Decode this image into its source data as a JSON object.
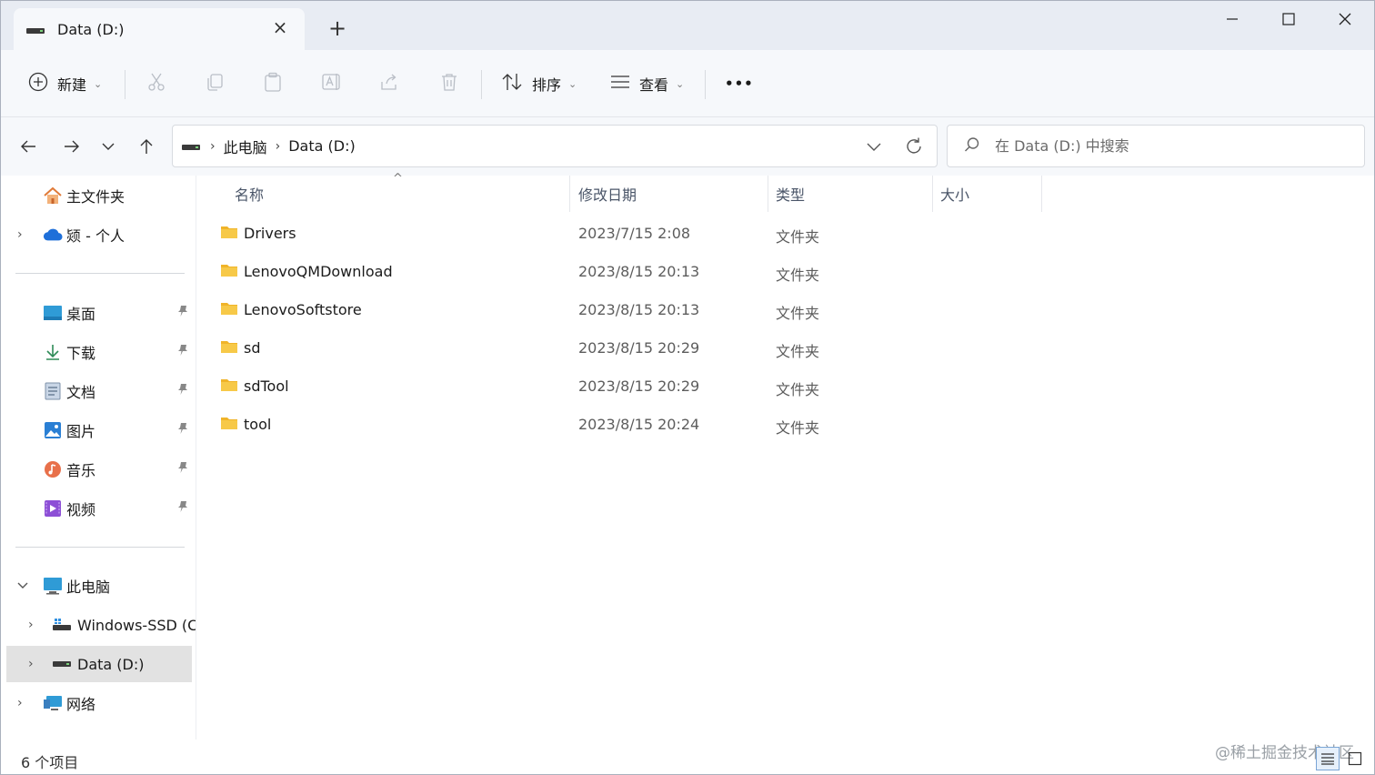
{
  "titlebar": {
    "tab_title": "Data (D:)",
    "tab_close": "×",
    "new_tab": "+",
    "minimize": "—",
    "close": "✕"
  },
  "toolbar": {
    "new_label": "新建",
    "sort_label": "排序",
    "view_label": "查看",
    "more": "•••",
    "caret": "⌄"
  },
  "address": {
    "crumbs": [
      "此电脑",
      "Data (D:)"
    ],
    "separator": "›",
    "search_placeholder": "在 Data (D:) 中搜索"
  },
  "sidebar": {
    "home": "主文件夹",
    "cloud": "颎 - 个人",
    "quick": [
      {
        "label": "桌面"
      },
      {
        "label": "下载"
      },
      {
        "label": "文档"
      },
      {
        "label": "图片"
      },
      {
        "label": "音乐"
      },
      {
        "label": "视频"
      }
    ],
    "pc": "此电脑",
    "drive_c": "Windows-SSD (C",
    "drive_d": "Data (D:)",
    "network": "网络",
    "pin_glyph": "📌",
    "chevron_right": "›",
    "chevron_down": "⌄"
  },
  "columns": {
    "name": "名称",
    "modified": "修改日期",
    "type": "类型",
    "size": "大小",
    "sort_glyph": "^"
  },
  "files": [
    {
      "name": "Drivers",
      "date": "2023/7/15 2:08",
      "type": "文件夹"
    },
    {
      "name": "LenovoQMDownload",
      "date": "2023/8/15 20:13",
      "type": "文件夹"
    },
    {
      "name": "LenovoSoftstore",
      "date": "2023/8/15 20:13",
      "type": "文件夹"
    },
    {
      "name": "sd",
      "date": "2023/8/15 20:29",
      "type": "文件夹"
    },
    {
      "name": "sdTool",
      "date": "2023/8/15 20:29",
      "type": "文件夹"
    },
    {
      "name": "tool",
      "date": "2023/8/15 20:24",
      "type": "文件夹"
    }
  ],
  "status": {
    "count": "6 个项目",
    "watermark": "@稀土掘金技术社区"
  },
  "colors": {
    "folder": "#f7c948",
    "accent": "#0067c0",
    "selected": "#e2e2e2"
  }
}
